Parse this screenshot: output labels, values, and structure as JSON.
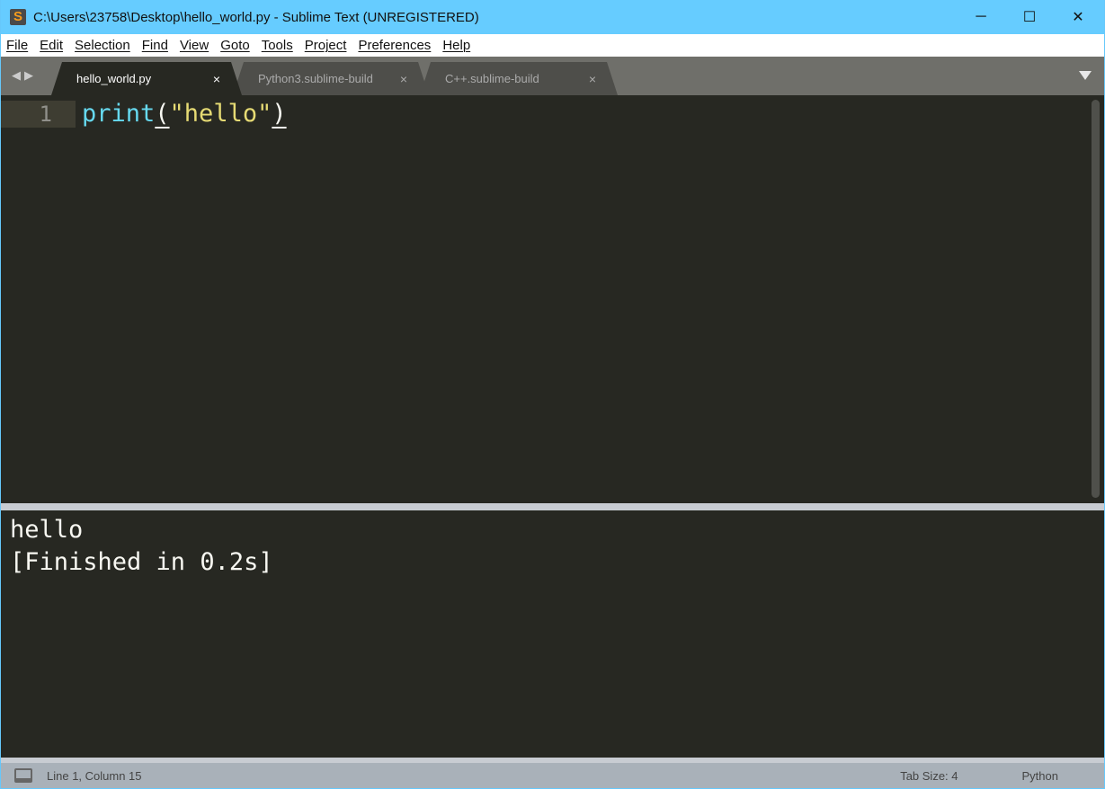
{
  "window": {
    "title": "C:\\Users\\23758\\Desktop\\hello_world.py - Sublime Text (UNREGISTERED)",
    "logo": "S"
  },
  "controls": {
    "minimize": "─",
    "maximize": "☐",
    "close": "✕"
  },
  "menu": [
    "File",
    "Edit",
    "Selection",
    "Find",
    "View",
    "Goto",
    "Tools",
    "Project",
    "Preferences",
    "Help"
  ],
  "tabs": [
    {
      "label": "hello_world.py",
      "active": true
    },
    {
      "label": "Python3.sublime-build",
      "active": false
    },
    {
      "label": "C++.sublime-build",
      "active": false
    }
  ],
  "tab_close": "×",
  "nav_arrows": "◀▶",
  "editor": {
    "line_number": "1",
    "code": {
      "fn": "print",
      "open": "(",
      "str": "\"hello\"",
      "close": ")"
    }
  },
  "output": {
    "lines": [
      "hello",
      "[Finished in 0.2s]"
    ]
  },
  "status": {
    "position": "Line 1, Column 15",
    "tab_size": "Tab Size: 4",
    "syntax": "Python"
  },
  "colors": {
    "fn": "#66d9ef",
    "string": "#e6db74",
    "background": "#272822",
    "titlebar": "#66ccff"
  }
}
